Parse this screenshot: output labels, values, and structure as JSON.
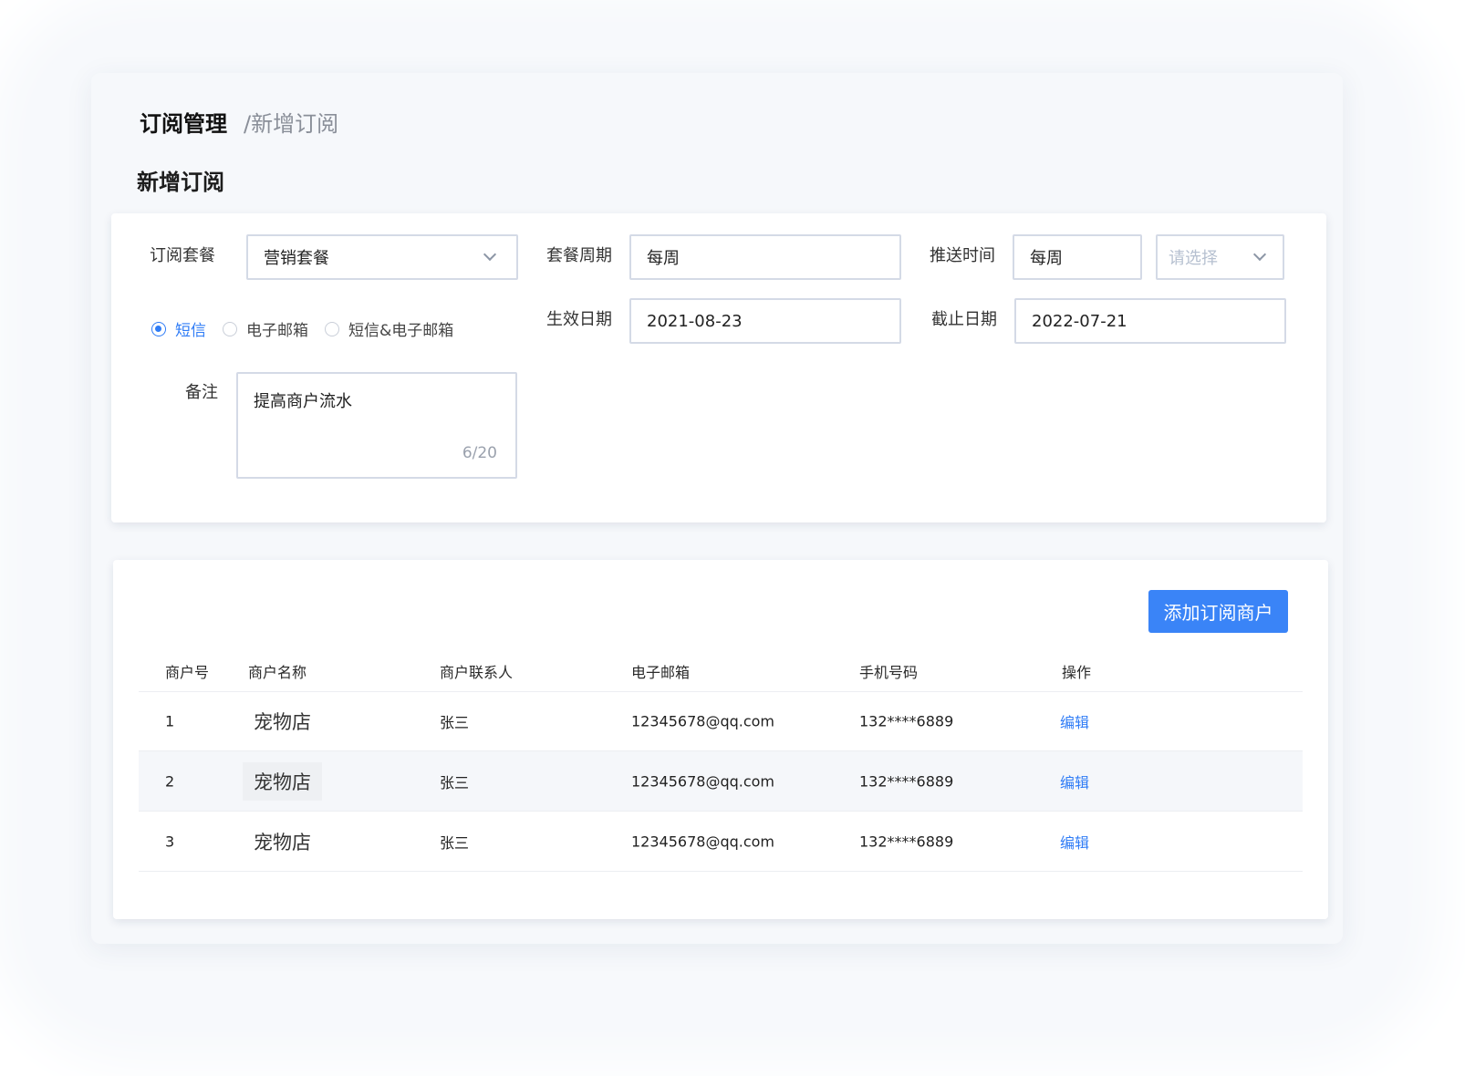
{
  "breadcrumb": {
    "root": "订阅管理",
    "current": "/新增订阅"
  },
  "page_title": "新增订阅",
  "form": {
    "package_label": "订阅套餐",
    "package_value": "营销套餐",
    "period_label": "套餐周期",
    "period_value": "每周",
    "push_label": "推送时间",
    "push_value": "每周",
    "push_placeholder": "请选择",
    "channels": [
      "短信",
      "电子邮箱",
      "短信&电子邮箱"
    ],
    "channel_selected": "短信",
    "start_label": "生效日期",
    "start_value": "2021-08-23",
    "end_label": "截止日期",
    "end_value": "2022-07-21",
    "note_label": "备注",
    "note_value": "提高商户流水",
    "note_count": "6/20"
  },
  "table": {
    "add_button": "添加订阅商户",
    "headers": [
      "商户号",
      "商户名称",
      "商户联系人",
      "电子邮箱",
      "手机号码",
      "操作"
    ],
    "rows": [
      {
        "id": "1",
        "name": "宠物店",
        "contact": "张三",
        "email": "12345678@qq.com",
        "phone": "132****6889",
        "action": "编辑"
      },
      {
        "id": "2",
        "name": "宠物店",
        "contact": "张三",
        "email": "12345678@qq.com",
        "phone": "132****6889",
        "action": "编辑"
      },
      {
        "id": "3",
        "name": "宠物店",
        "contact": "张三",
        "email": "12345678@qq.com",
        "phone": "132****6889",
        "action": "编辑"
      }
    ]
  },
  "colors": {
    "accent": "#3a84f7",
    "border": "#d4dae6",
    "panel_bg": "#f6f8fb"
  },
  "icons": {
    "dropdown": "chevron-down-icon",
    "radio": "radio-icon"
  }
}
